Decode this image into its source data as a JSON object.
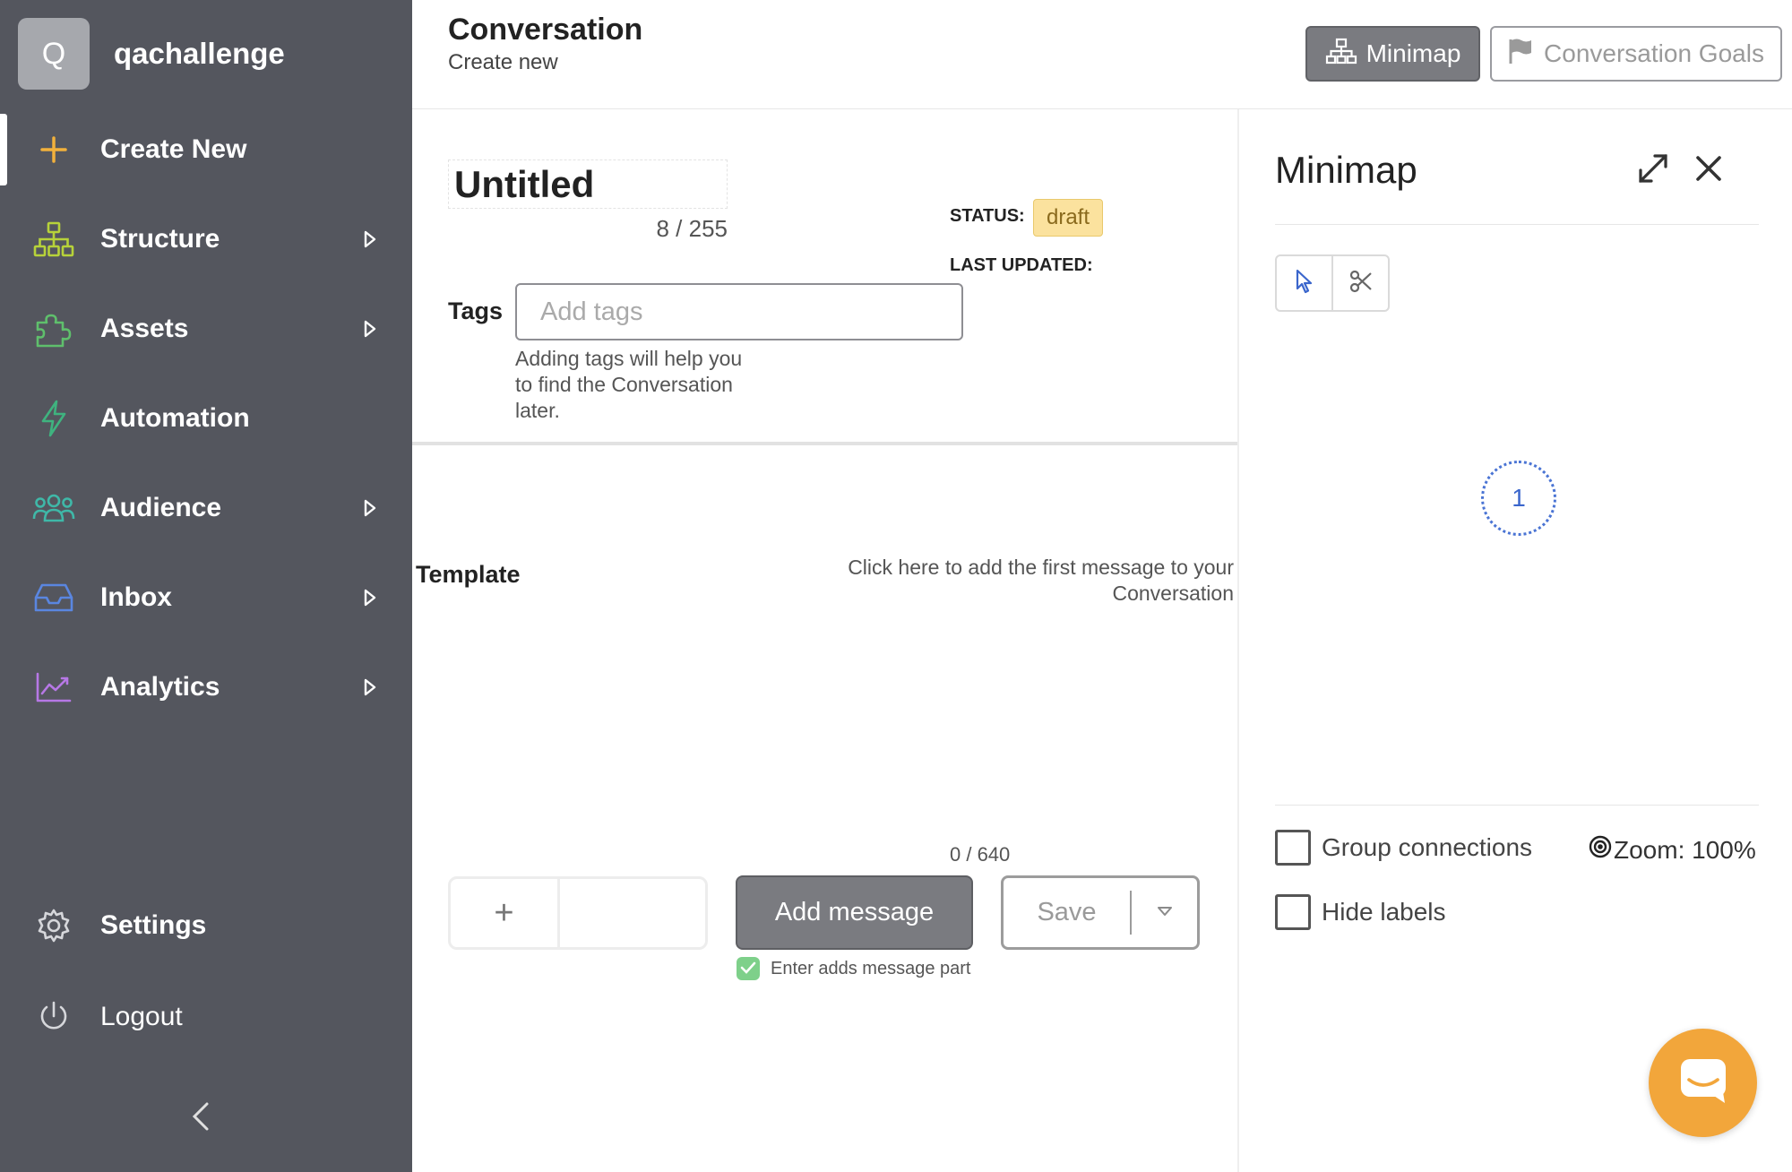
{
  "sidebar": {
    "workspace_initial": "Q",
    "workspace_name": "qachallenge",
    "items": [
      {
        "label": "Create New",
        "icon": "plus-icon"
      },
      {
        "label": "Structure",
        "icon": "sitemap-icon"
      },
      {
        "label": "Assets",
        "icon": "puzzle-icon"
      },
      {
        "label": "Automation",
        "icon": "lightning-icon"
      },
      {
        "label": "Audience",
        "icon": "users-icon"
      },
      {
        "label": "Inbox",
        "icon": "inbox-icon"
      },
      {
        "label": "Analytics",
        "icon": "chart-icon"
      }
    ],
    "settings_label": "Settings",
    "logout_label": "Logout"
  },
  "header": {
    "title": "Conversation",
    "subtitle": "Create new",
    "minimap_button": "Minimap",
    "goals_button": "Conversation Goals"
  },
  "editor": {
    "title_value": "Untitled",
    "title_count": "8 / 255",
    "status_label": "STATUS:",
    "status_value": "draft",
    "last_updated_label": "LAST UPDATED:",
    "tags_label": "Tags",
    "tags_placeholder": "Add tags",
    "tags_help": "Adding tags will help you to find the Conversation later.",
    "template_label": "Template",
    "first_message_hint": "Click here to add the first message to your Conversation",
    "message_count": "0 / 640",
    "plus_label": "+",
    "add_message_button": "Add message",
    "save_button": "Save",
    "enter_adds_label": "Enter adds message part"
  },
  "minimap": {
    "title": "Minimap",
    "node_label": "1",
    "group_connections_label": "Group connections",
    "hide_labels_label": "Hide labels",
    "zoom_text": "Zoom: 100%"
  },
  "colors": {
    "sidebar_bg": "#54565e",
    "accent_create": "#f2b13c",
    "status_draft": "#fbe29e",
    "node_blue": "#3b66cc",
    "chat_orange": "#f2a63b",
    "check_green": "#7ed08a"
  }
}
